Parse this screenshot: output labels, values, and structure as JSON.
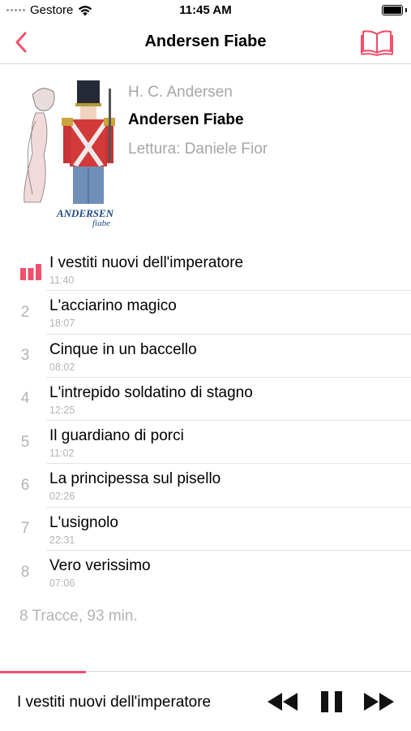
{
  "status_bar": {
    "carrier": "Gestore",
    "time": "11:45 AM"
  },
  "nav": {
    "title": "Andersen Fiabe"
  },
  "album": {
    "author": "H. C. Andersen",
    "title": "Andersen Fiabe",
    "reader": "Lettura: Daniele Fior",
    "cover_text_1": "ANDERSEN",
    "cover_text_2": "fiabe"
  },
  "tracks": [
    {
      "number": "1",
      "title": "I vestiti nuovi dell'imperatore",
      "duration": "11:40",
      "playing": true
    },
    {
      "number": "2",
      "title": "L'acciarino magico",
      "duration": "18:07",
      "playing": false
    },
    {
      "number": "3",
      "title": "Cinque in un baccello",
      "duration": "08:02",
      "playing": false
    },
    {
      "number": "4",
      "title": "L'intrepido soldatino di stagno",
      "duration": "12:25",
      "playing": false
    },
    {
      "number": "5",
      "title": "Il guardiano di porci",
      "duration": "11:02",
      "playing": false
    },
    {
      "number": "6",
      "title": "La principessa sul pisello",
      "duration": "02:26",
      "playing": false
    },
    {
      "number": "7",
      "title": "L'usignolo",
      "duration": "22:31",
      "playing": false
    },
    {
      "number": "8",
      "title": "Vero verissimo",
      "duration": "07:06",
      "playing": false
    }
  ],
  "summary": "8 Tracce, 93 min.",
  "player": {
    "now_playing": "I vestiti nuovi dell'imperatore",
    "progress": 0.21,
    "state": "playing"
  },
  "colors": {
    "accent": "#f0506e",
    "secondary_text": "#b4b4b4",
    "cover_text": "#1f4a85"
  },
  "icons": {
    "back": "chevron-left-icon",
    "book": "open-book-icon",
    "now_playing": "equalizer-icon",
    "rewind": "rewind-icon",
    "pause": "pause-icon",
    "forward": "fast-forward-icon"
  }
}
